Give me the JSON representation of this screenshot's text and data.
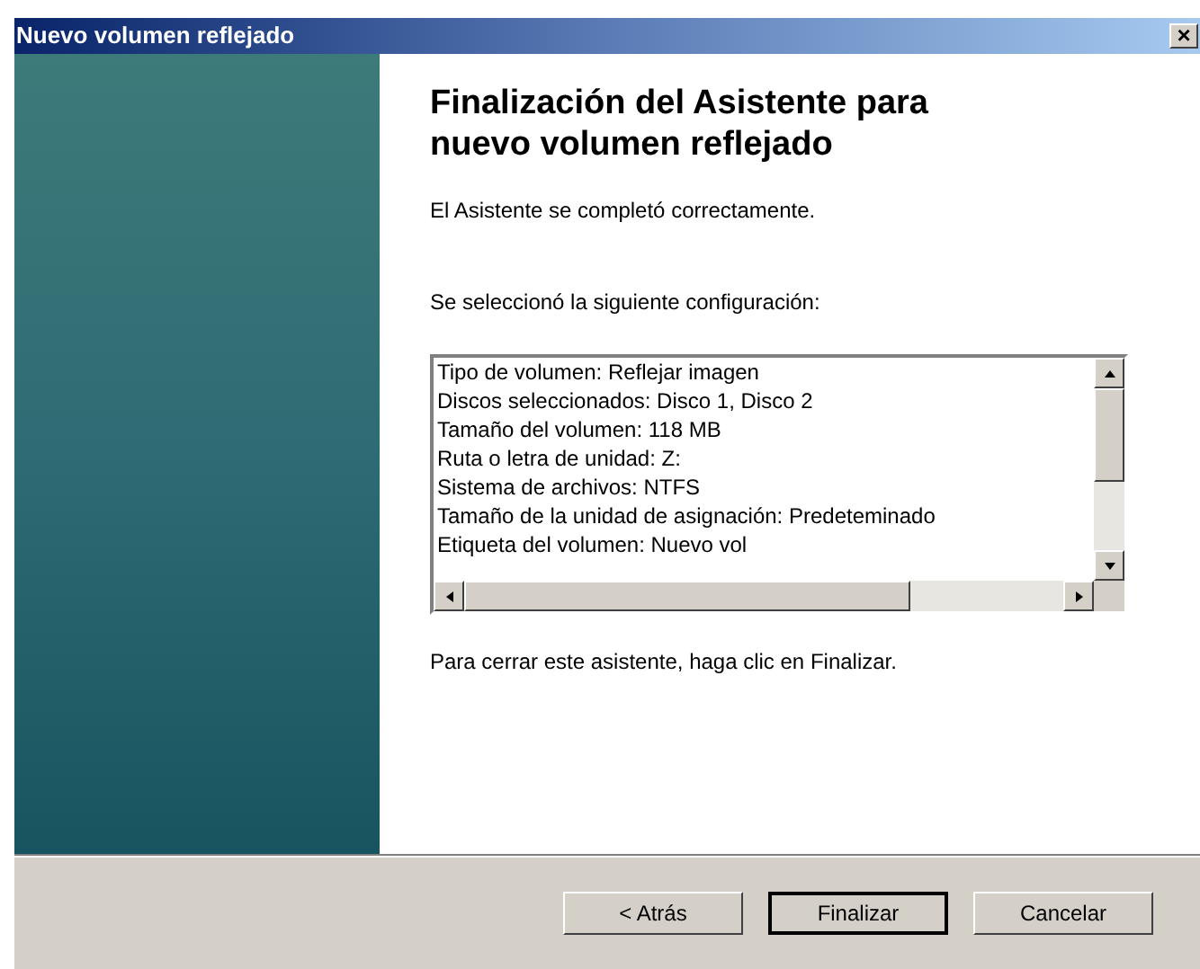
{
  "window": {
    "title": "Nuevo volumen reflejado",
    "close": "×"
  },
  "heading": "Finalización del Asistente para nuevo volumen reflejado",
  "status_text": "El Asistente se completó correctamente.",
  "summary_label": "Se seleccionó la siguiente configuración:",
  "summary_lines": [
    "Tipo de volumen: Reflejar imagen",
    "Discos seleccionados: Disco 1, Disco 2",
    "Tamaño del volumen: 118 MB",
    "Ruta o letra de unidad: Z:",
    "Sistema de archivos: NTFS",
    "Tamaño de la unidad de asignación: Predeteminado",
    "Etiqueta del volumen: Nuevo vol"
  ],
  "footer_text": "Para cerrar este asistente, haga clic en Finalizar.",
  "buttons": [
    {
      "label": "< Atrás",
      "default": false
    },
    {
      "label": "Finalizar",
      "default": true
    },
    {
      "label": "Cancelar",
      "default": false
    }
  ]
}
